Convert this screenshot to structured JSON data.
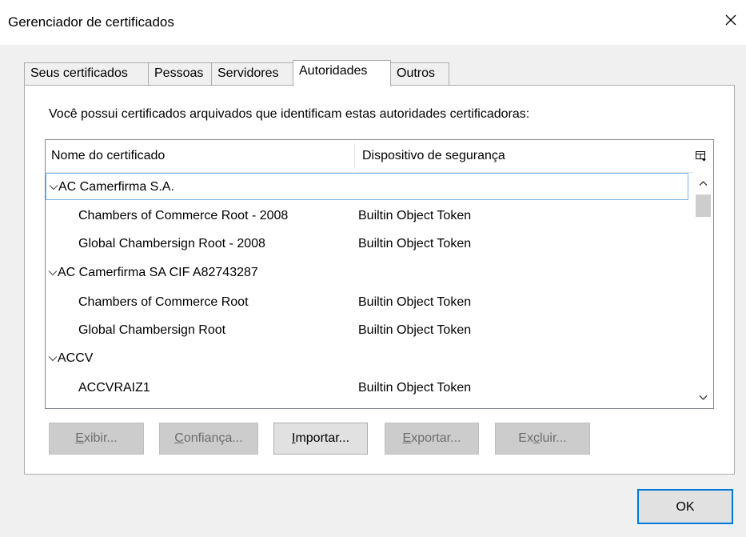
{
  "window": {
    "title": "Gerenciador de certificados",
    "close_icon": "close-icon"
  },
  "tabs": [
    {
      "label": "Seus certificados",
      "active": false
    },
    {
      "label": "Pessoas",
      "active": false
    },
    {
      "label": "Servidores",
      "active": false
    },
    {
      "label": "Autoridades",
      "active": true
    },
    {
      "label": "Outros",
      "active": false
    }
  ],
  "description": "Você possui certificados arquivados que identificam estas autoridades certificadoras:",
  "tree": {
    "columns": [
      "Nome do certificado",
      "Dispositivo de segurança"
    ],
    "column_picker_icon": "column-picker-icon",
    "rows": [
      {
        "type": "group",
        "name": "AC Camerfirma S.A.",
        "device": ""
      },
      {
        "type": "item",
        "name": "Chambers of Commerce Root - 2008",
        "device": "Builtin Object Token"
      },
      {
        "type": "item",
        "name": "Global Chambersign Root - 2008",
        "device": "Builtin Object Token"
      },
      {
        "type": "group",
        "name": "AC Camerfirma SA CIF A82743287",
        "device": ""
      },
      {
        "type": "item",
        "name": "Chambers of Commerce Root",
        "device": "Builtin Object Token"
      },
      {
        "type": "item",
        "name": "Global Chambersign Root",
        "device": "Builtin Object Token"
      },
      {
        "type": "group",
        "name": "ACCV",
        "device": ""
      },
      {
        "type": "item",
        "name": "ACCVRAIZ1",
        "device": "Builtin Object Token"
      }
    ]
  },
  "buttons": {
    "view": {
      "pre": "",
      "key": "E",
      "post": "xibir..."
    },
    "trust": {
      "pre": "",
      "key": "C",
      "post": "onfiança..."
    },
    "import": {
      "pre": "",
      "key": "I",
      "post": "mportar..."
    },
    "export": {
      "pre": "",
      "key": "E",
      "post": "xportar..."
    },
    "delete": {
      "pre": "Ex",
      "key": "c",
      "post": "luir..."
    },
    "ok": "OK"
  },
  "colors": {
    "focus_border": "#7ab3e6",
    "default_button_border": "#0078d7"
  }
}
